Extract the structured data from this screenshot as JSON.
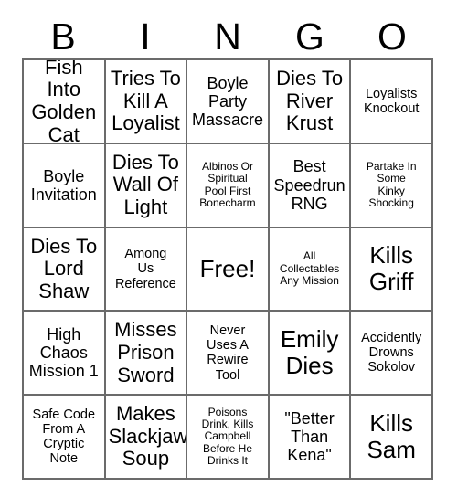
{
  "card": {
    "headers": [
      "B",
      "I",
      "N",
      "G",
      "O"
    ],
    "rows": [
      [
        {
          "text": "Fish Into\nGolden\nCat",
          "size": "lg"
        },
        {
          "text": "Tries To\nKill A\nLoyalist",
          "size": "lg"
        },
        {
          "text": "Boyle\nParty\nMassacre",
          "size": "md"
        },
        {
          "text": "Dies To\nRiver\nKrust",
          "size": "lg"
        },
        {
          "text": "Loyalists\nKnockout",
          "size": "sm"
        }
      ],
      [
        {
          "text": "Boyle\nInvitation",
          "size": "md"
        },
        {
          "text": "Dies To\nWall Of\nLight",
          "size": "lg"
        },
        {
          "text": "Albinos Or\nSpiritual\nPool First\nBonecharm",
          "size": "xs"
        },
        {
          "text": "Best\nSpeedrun\nRNG",
          "size": "md"
        },
        {
          "text": "Partake In\nSome\nKinky\nShocking",
          "size": "xs"
        }
      ],
      [
        {
          "text": "Dies To\nLord\nShaw",
          "size": "lg"
        },
        {
          "text": "Among\nUs\nReference",
          "size": "sm"
        },
        {
          "text": "Free!",
          "size": "xl"
        },
        {
          "text": "All\nCollectables\nAny Mission",
          "size": "xs"
        },
        {
          "text": "Kills\nGriff",
          "size": "xl"
        }
      ],
      [
        {
          "text": "High\nChaos\nMission 1",
          "size": "md"
        },
        {
          "text": "Misses\nPrison\nSword",
          "size": "lg"
        },
        {
          "text": "Never\nUses A\nRewire\nTool",
          "size": "sm"
        },
        {
          "text": "Emily\nDies",
          "size": "xl"
        },
        {
          "text": "Accidently\nDrowns\nSokolov",
          "size": "sm"
        }
      ],
      [
        {
          "text": "Safe Code\nFrom A\nCryptic\nNote",
          "size": "sm"
        },
        {
          "text": "Makes\nSlackjaw\nSoup",
          "size": "lg"
        },
        {
          "text": "Poisons\nDrink, Kills\nCampbell\nBefore He\nDrinks It",
          "size": "xs"
        },
        {
          "text": "\"Better\nThan\nKena\"",
          "size": "md"
        },
        {
          "text": "Kills\nSam",
          "size": "xl"
        }
      ]
    ]
  },
  "colors": {
    "grid_line": "#6b6b6b",
    "text": "#000000",
    "background": "#ffffff"
  }
}
